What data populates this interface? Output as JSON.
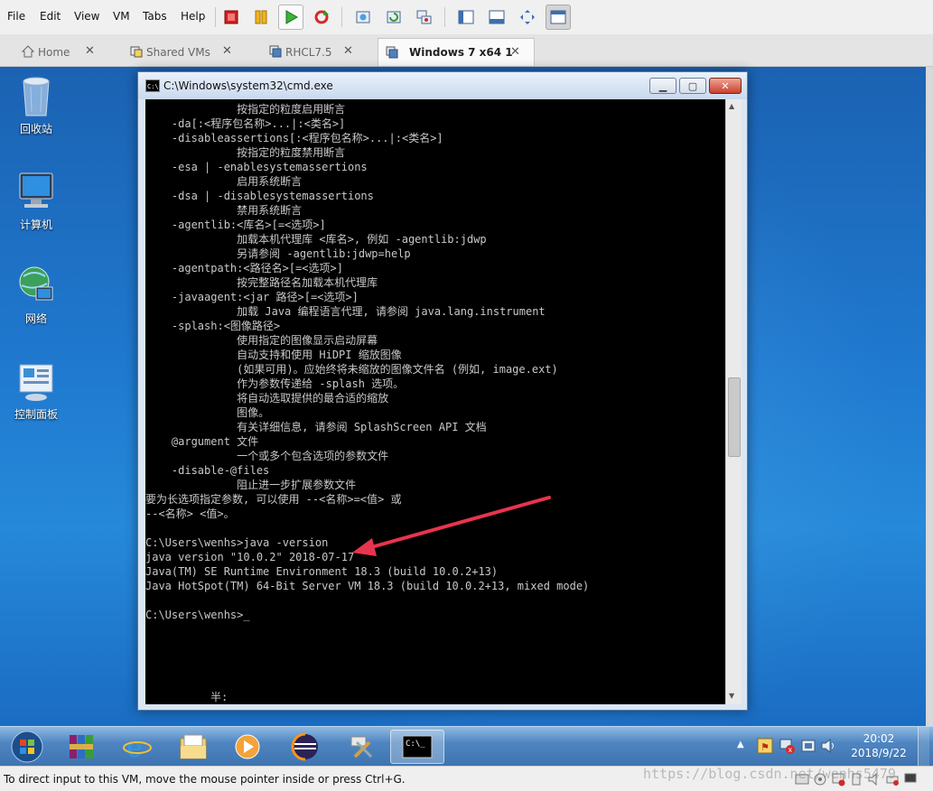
{
  "menubar": {
    "items": [
      "File",
      "Edit",
      "View",
      "VM",
      "Tabs",
      "Help"
    ]
  },
  "toolbar": {
    "buttons": [
      "power-off-icon",
      "suspend-icon",
      "play-icon",
      "refresh-icon",
      "snapshot-icon",
      "snapshot-revert-icon",
      "snapshot-manager-icon",
      "sidebar-icon",
      "console-view-icon",
      "fullscreen-icon",
      "unity-icon"
    ]
  },
  "tabs": [
    {
      "label": "Home",
      "icon": "home-icon"
    },
    {
      "label": "Shared VMs",
      "icon": "shared-vms-icon"
    },
    {
      "label": "RHCL7.5",
      "icon": "vm-icon"
    },
    {
      "label": "Windows 7 x64 1",
      "icon": "vm-icon",
      "selected": true
    }
  ],
  "desktop_icons": [
    {
      "label": "回收站",
      "icon": "recycle-bin-icon"
    },
    {
      "label": "计算机",
      "icon": "computer-icon"
    },
    {
      "label": "网络",
      "icon": "network-icon"
    },
    {
      "label": "控制面板",
      "icon": "control-panel-icon"
    }
  ],
  "cmd": {
    "title": "C:\\Windows\\system32\\cmd.exe",
    "lines": [
      "              按指定的粒度启用断言",
      "    -da[:<程序包名称>...|:<类名>]",
      "    -disableassertions[:<程序包名称>...|:<类名>]",
      "              按指定的粒度禁用断言",
      "    -esa | -enablesystemassertions",
      "              启用系统断言",
      "    -dsa | -disablesystemassertions",
      "              禁用系统断言",
      "    -agentlib:<库名>[=<选项>]",
      "              加载本机代理库 <库名>, 例如 -agentlib:jdwp",
      "              另请参阅 -agentlib:jdwp=help",
      "    -agentpath:<路径名>[=<选项>]",
      "              按完整路径名加载本机代理库",
      "    -javaagent:<jar 路径>[=<选项>]",
      "              加载 Java 编程语言代理, 请参阅 java.lang.instrument",
      "    -splash:<图像路径>",
      "              使用指定的图像显示启动屏幕",
      "              自动支持和使用 HiDPI 缩放图像",
      "              (如果可用)。应始终将未缩放的图像文件名 (例如, image.ext)",
      "              作为参数传递给 -splash 选项。",
      "              将自动选取提供的最合适的缩放",
      "              图像。",
      "              有关详细信息, 请参阅 SplashScreen API 文档",
      "    @argument 文件",
      "              一个或多个包含选项的参数文件",
      "    -disable-@files",
      "              阻止进一步扩展参数文件",
      "要为长选项指定参数, 可以使用 --<名称>=<值> 或",
      "--<名称> <值>。",
      "",
      "C:\\Users\\wenhs>java -version",
      "java version \"10.0.2\" 2018-07-17",
      "Java(TM) SE Runtime Environment 18.3 (build 10.0.2+13)",
      "Java HotSpot(TM) 64-Bit Server VM 18.3 (build 10.0.2+13, mixed mode)",
      "",
      "C:\\Users\\wenhs>_"
    ],
    "ime": "半:"
  },
  "taskbar": {
    "apps": [
      "start-orb",
      "winrar-icon",
      "ie-icon",
      "explorer-icon",
      "media-player-icon",
      "eclipse-icon",
      "tools-icon",
      "cmd-icon"
    ],
    "clock_time": "20:02",
    "clock_date": "2018/9/22"
  },
  "status": {
    "text": "To direct input to this VM, move the mouse pointer inside or press Ctrl+G."
  },
  "watermark": "https://blog.csdn.net/wenhs5479",
  "colors": {
    "desktop": "#1f79cf",
    "console_bg": "#000000",
    "console_text": "#c8c8c8",
    "annotation_arrow": "#e8344e"
  }
}
